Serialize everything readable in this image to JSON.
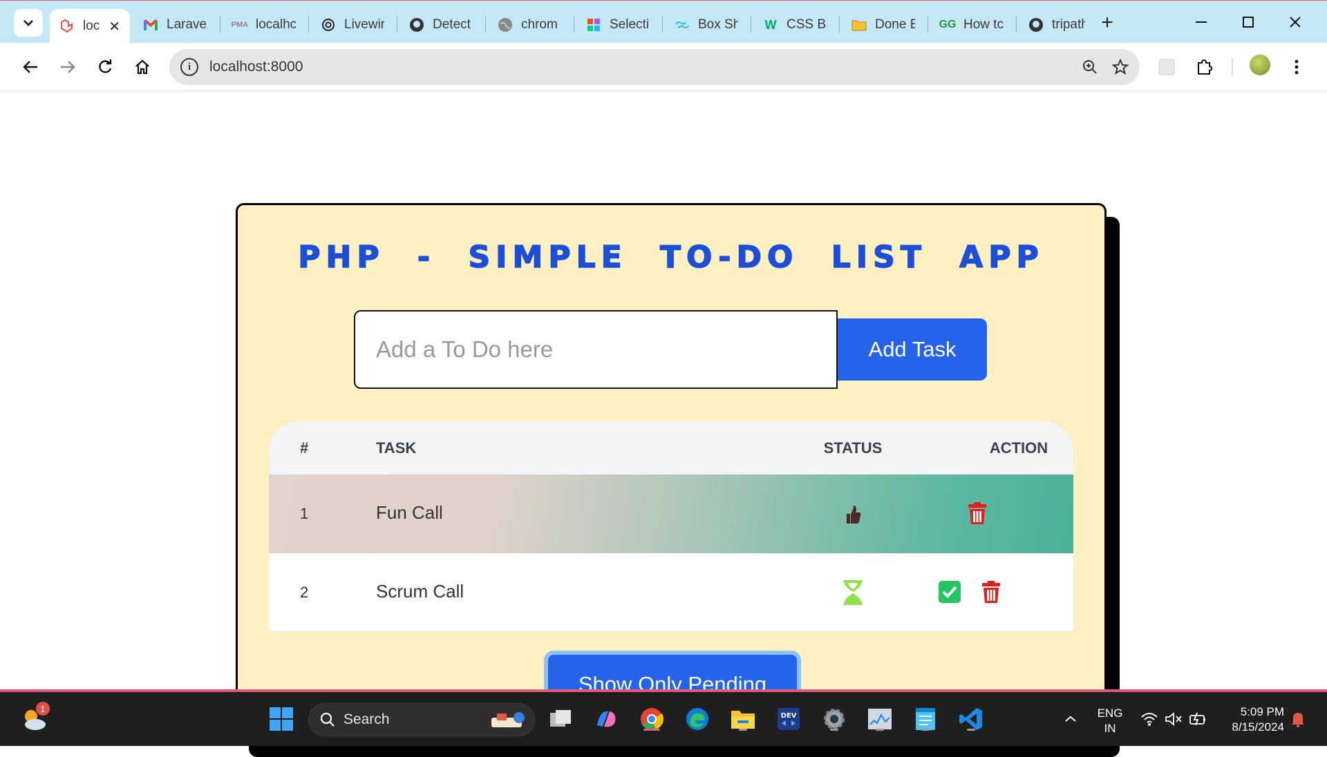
{
  "browser": {
    "tabs": [
      {
        "title": "loc",
        "icon": "laravel-icon",
        "active": true
      },
      {
        "title": "Laravel",
        "icon": "gmail-icon"
      },
      {
        "title": "localhc",
        "icon": "phpmyadmin-icon"
      },
      {
        "title": "Livewir",
        "icon": "openai-icon"
      },
      {
        "title": "Detect",
        "icon": "github-icon"
      },
      {
        "title": "chrom",
        "icon": "globe-icon"
      },
      {
        "title": "Selecti",
        "icon": "figma-icon"
      },
      {
        "title": "Box Sh",
        "icon": "tailwind-icon"
      },
      {
        "title": "CSS Bo",
        "icon": "w3schools-icon"
      },
      {
        "title": "Done E",
        "icon": "folder-icon"
      },
      {
        "title": "How tc",
        "icon": "geeksforgeeks-icon"
      },
      {
        "title": "tripath",
        "icon": "github-icon"
      }
    ],
    "url": "localhost:8000"
  },
  "app": {
    "title": "PHP - SIMPLE TO-DO LIST APP",
    "input_placeholder": "Add a To Do here",
    "add_button": "Add Task",
    "table": {
      "headers": [
        "#",
        "TASK",
        "STATUS",
        "ACTION"
      ],
      "rows": [
        {
          "num": "1",
          "task": "Fun Call",
          "status": "done",
          "status_icon": "thumbs-up-icon",
          "actions": [
            "delete"
          ]
        },
        {
          "num": "2",
          "task": "Scrum Call",
          "status": "pending",
          "status_icon": "hourglass-icon",
          "actions": [
            "complete",
            "delete"
          ]
        }
      ]
    },
    "filter_button": "Show Only Pending",
    "colors": {
      "primary": "#2563eb",
      "card_bg": "#fdf0c2",
      "delete": "#e11d1d",
      "complete": "#22c55e"
    }
  },
  "taskbar": {
    "search_label": "Search",
    "weather_badge": "1",
    "language": "ENG",
    "region": "IN",
    "time": "5:09 PM",
    "date": "8/15/2024"
  }
}
